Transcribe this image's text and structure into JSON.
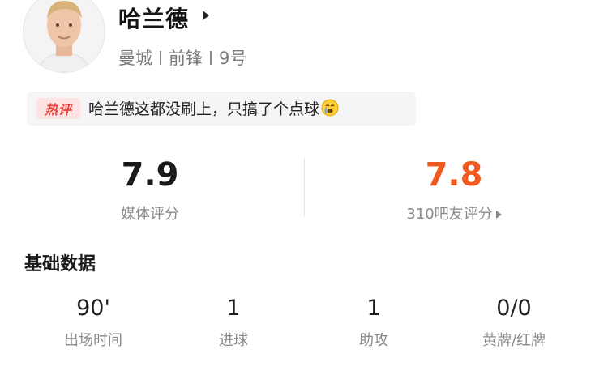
{
  "player": {
    "name": "哈兰德",
    "team": "曼城",
    "position": "前锋",
    "number": "9号"
  },
  "hot_comment": {
    "tag": "热评",
    "text": "哈兰德这都没刷上，只搞了个点球",
    "emoji": "crying-face-icon"
  },
  "ratings": {
    "media": {
      "value": "7.9",
      "label": "媒体评分"
    },
    "fans": {
      "value": "7.8",
      "label": "310吧友评分"
    }
  },
  "basic_stats": {
    "title": "基础数据",
    "items": [
      {
        "value": "90'",
        "label": "出场时间"
      },
      {
        "value": "1",
        "label": "进球"
      },
      {
        "value": "1",
        "label": "助攻"
      },
      {
        "value": "0/0",
        "label": "黄牌/红牌"
      }
    ]
  },
  "colors": {
    "fan_rating": "#f05a1e",
    "hot_tag": "#e8443a",
    "hot_tag_bg": "#ffe3e3"
  },
  "icons": {
    "name_arrow": "caret-right-icon",
    "fan_arrow": "caret-right-icon"
  }
}
